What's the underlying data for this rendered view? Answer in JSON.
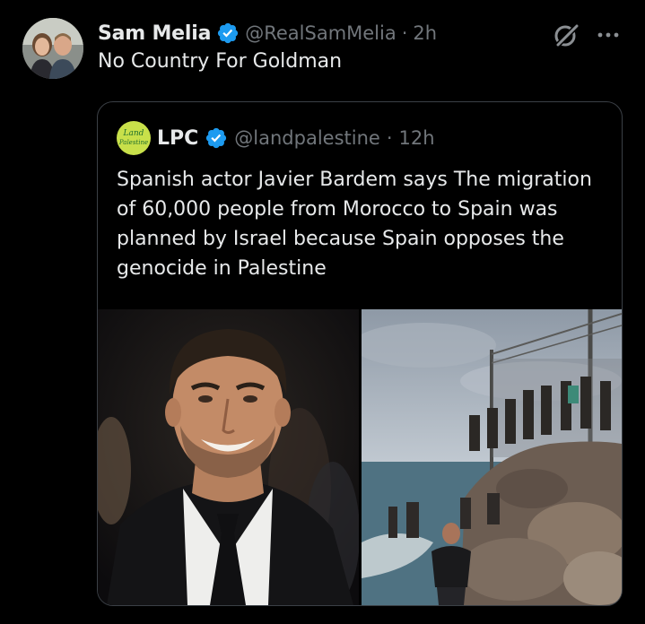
{
  "post": {
    "author_name": "Sam Melia",
    "handle": "@RealSamMelia",
    "separator": "·",
    "time": "2h",
    "text": "No Country For Goldman",
    "avatar_icon": "profile-photo-couple",
    "verified_icon": "verified-badge-icon",
    "more_icon": "more-options-icon",
    "grok_icon": "grok-icon"
  },
  "quoted_post": {
    "author_name": "LPC",
    "handle": "@landpalestine",
    "separator": "·",
    "time": "12h",
    "avatar_logo": "Land Palestine",
    "text": "Spanish actor Javier Bardem says The migration of 60,000 people from Morocco to Spain was planned by Israel because Spain opposes the genocide in Palestine",
    "media": [
      {
        "description_icon": "photo-man-smiling-suit"
      },
      {
        "description_icon": "photo-people-climbing-rocks-fence"
      }
    ]
  },
  "colors": {
    "background": "#000000",
    "text_primary": "#e7e9ea",
    "text_secondary": "#71767b",
    "verified_blue": "#1d9bf0",
    "border": "#3b4046"
  }
}
